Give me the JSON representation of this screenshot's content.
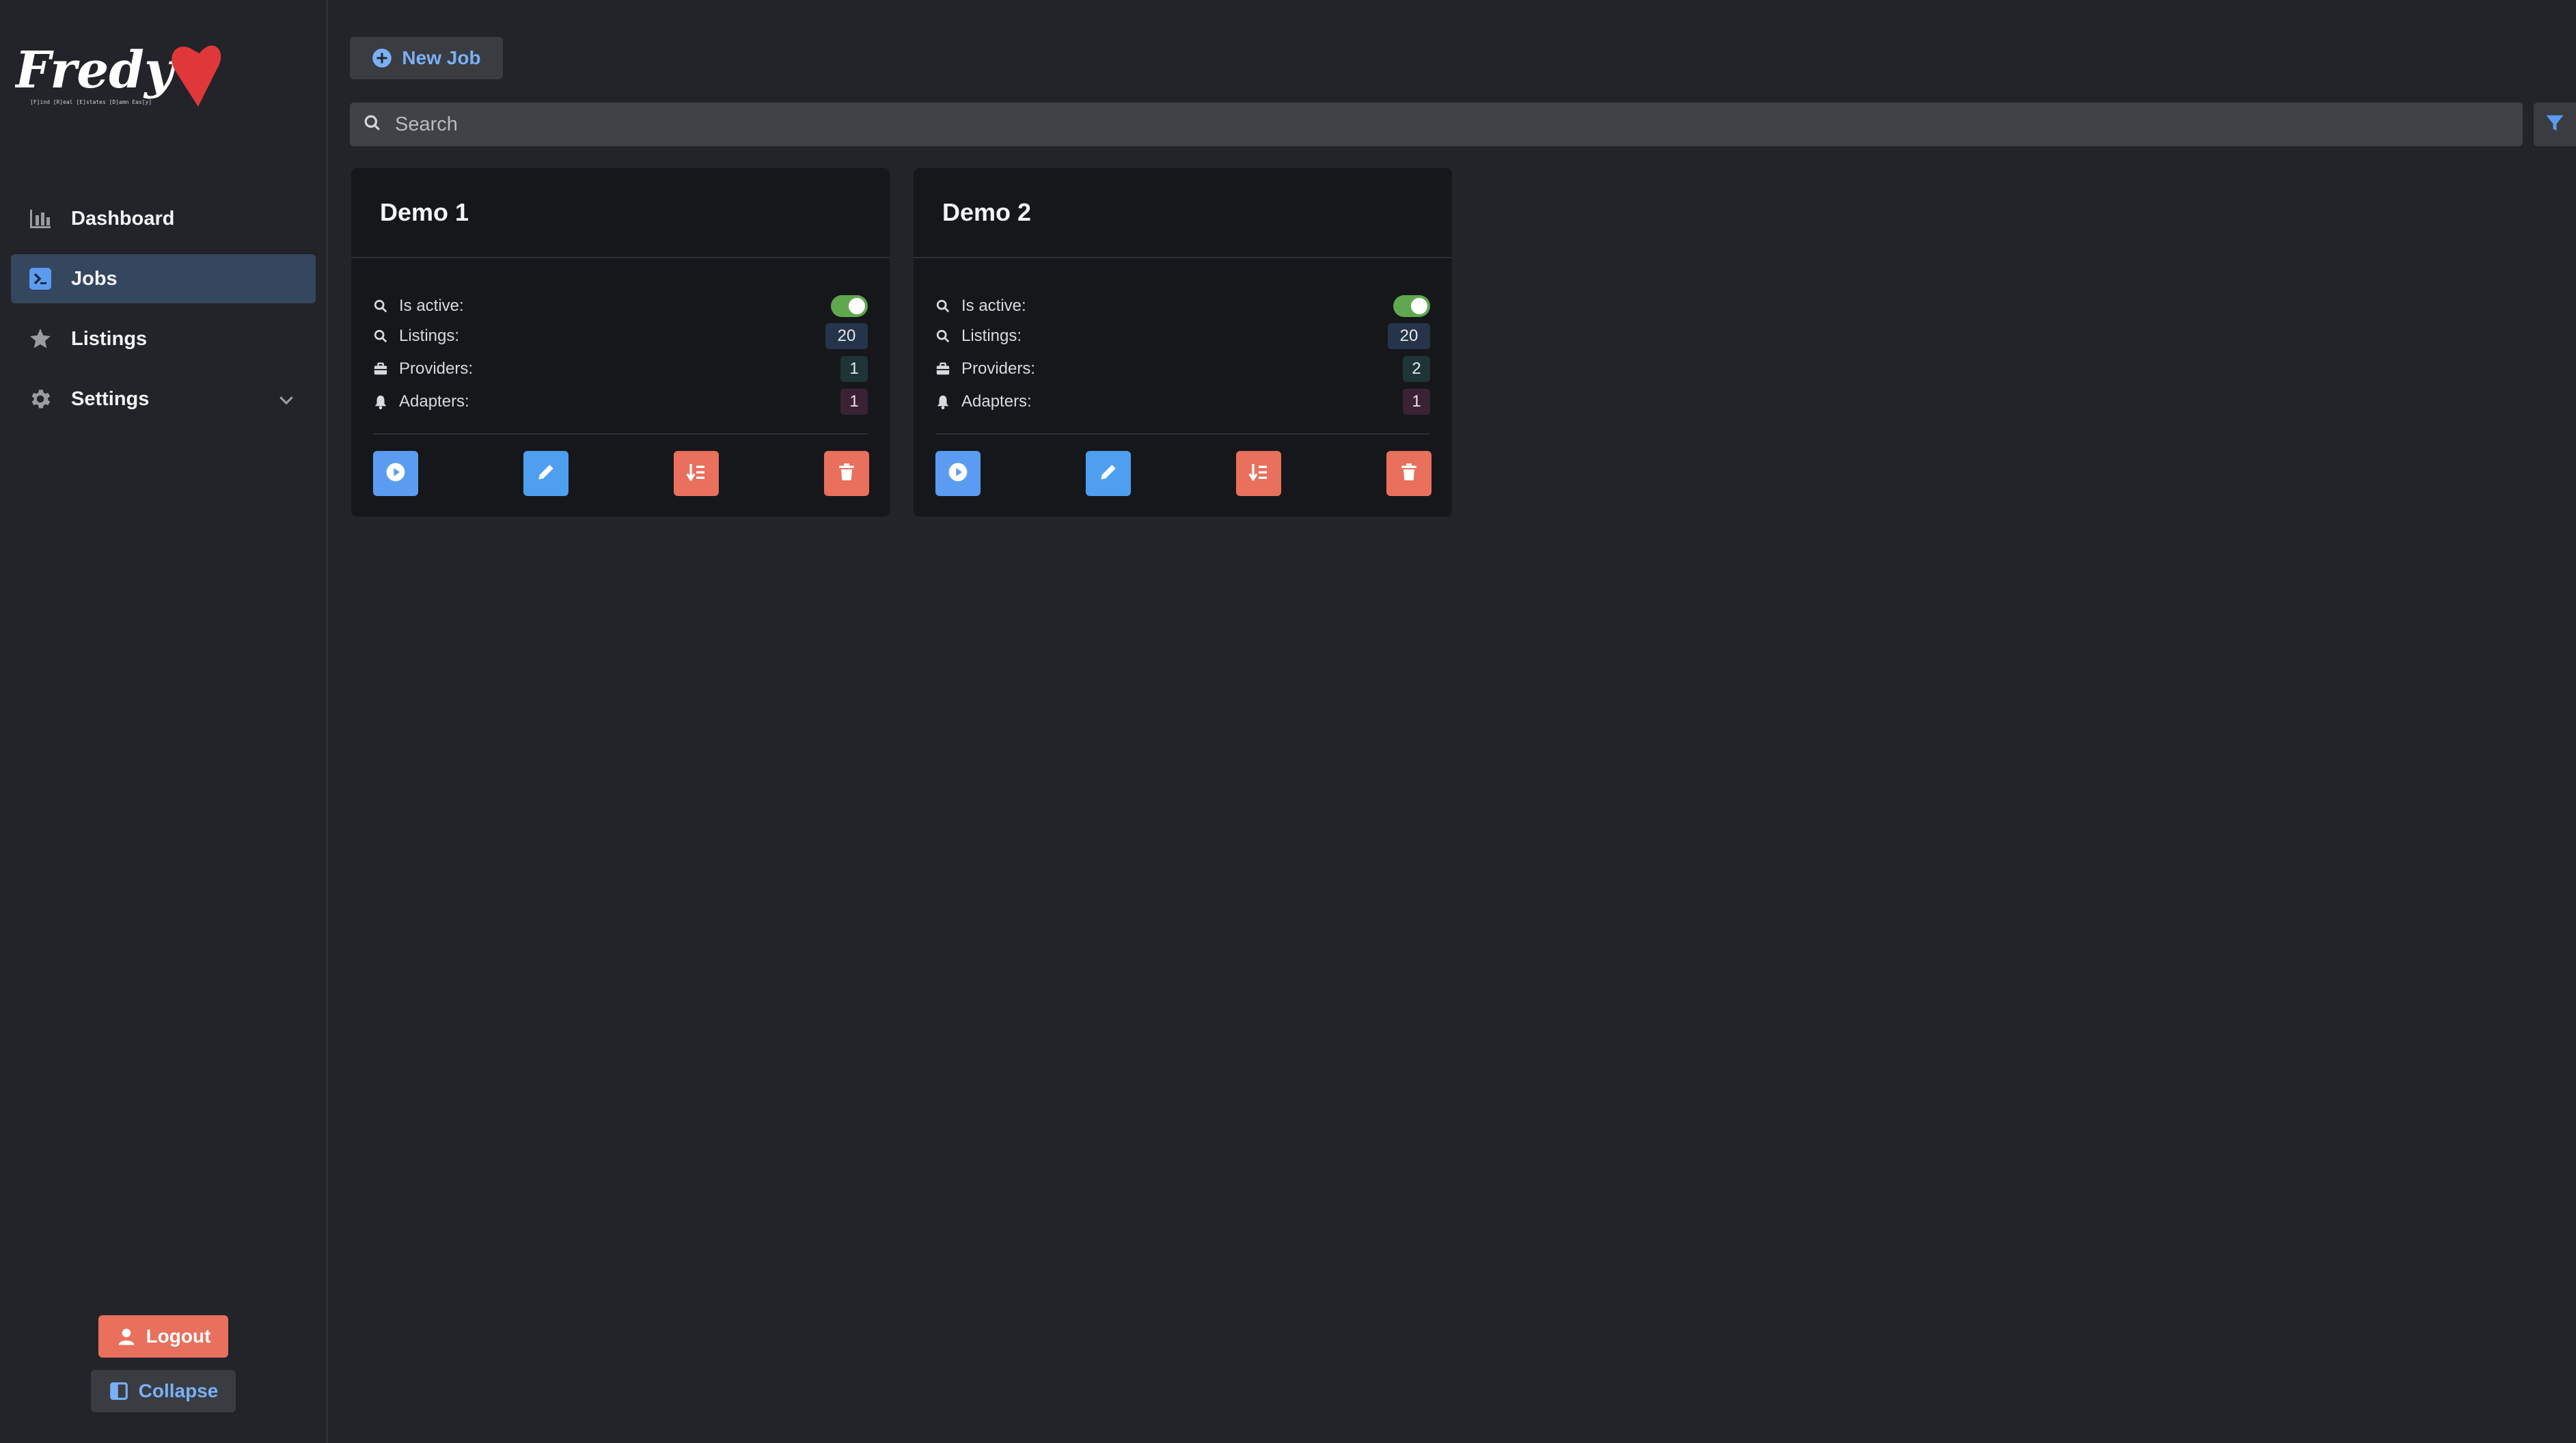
{
  "app": {
    "logo_text": "Fredy",
    "logo_tagline": "[F]ind [R]eal [E]states [D]amn Eas[y]"
  },
  "sidebar": {
    "items": [
      {
        "label": "Dashboard",
        "icon": "bar-chart-icon",
        "active": false
      },
      {
        "label": "Jobs",
        "icon": "terminal-icon",
        "active": true
      },
      {
        "label": "Listings",
        "icon": "star-icon",
        "active": false
      },
      {
        "label": "Settings",
        "icon": "gear-icon",
        "active": false,
        "expandable": true
      }
    ],
    "logout_label": "Logout",
    "collapse_label": "Collapse"
  },
  "toolbar": {
    "new_job_label": "New Job"
  },
  "search": {
    "placeholder": "Search",
    "value": ""
  },
  "labels": {
    "is_active": "Is active:",
    "listings": "Listings:",
    "providers": "Providers:",
    "adapters": "Adapters:"
  },
  "jobs": [
    {
      "name": "Demo 1",
      "is_active": true,
      "listings": "20",
      "providers": "1",
      "adapters": "1"
    },
    {
      "name": "Demo 2",
      "is_active": true,
      "listings": "20",
      "providers": "2",
      "adapters": "1"
    }
  ],
  "colors": {
    "background": "#232429",
    "card": "#16171b",
    "accent_blue": "#5b9cf2",
    "accent_red": "#e8705c",
    "toggle_green": "#5fa84e",
    "active_nav": "#35465f"
  }
}
